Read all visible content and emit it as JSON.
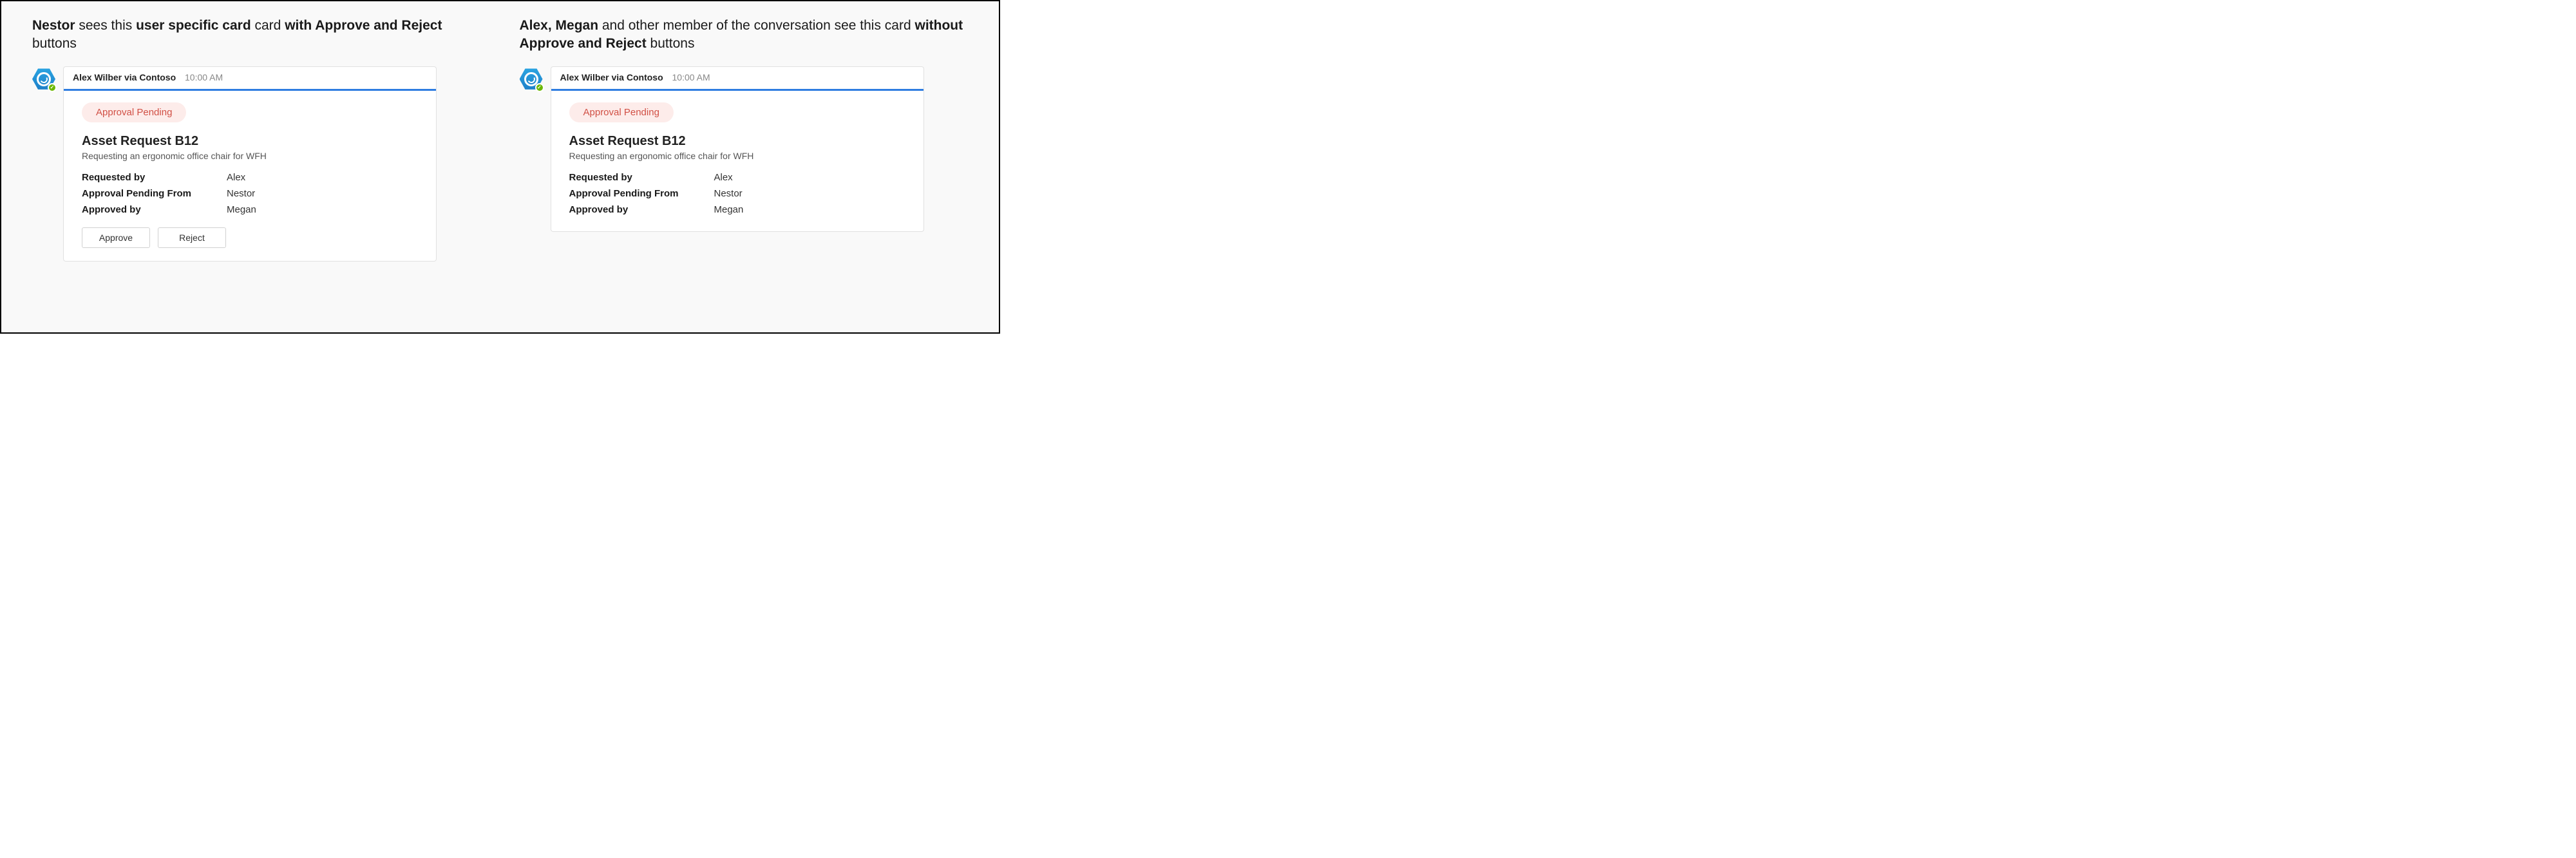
{
  "left": {
    "caption_segments": [
      {
        "text": "Nestor",
        "bold": true
      },
      {
        "text": " sees this ",
        "bold": false
      },
      {
        "text": "user specific card",
        "bold": true
      },
      {
        "text": " card ",
        "bold": false
      },
      {
        "text": "with Approve and Reject",
        "bold": true
      },
      {
        "text": " buttons",
        "bold": false
      }
    ],
    "sender": "Alex Wilber via Contoso",
    "timestamp": "10:00 AM",
    "status": "Approval Pending",
    "title": "Asset Request B12",
    "description": "Requesting an ergonomic office chair for WFH",
    "fields": [
      {
        "label": "Requested by",
        "value": "Alex"
      },
      {
        "label": "Approval Pending From",
        "value": "Nestor"
      },
      {
        "label": "Approved by",
        "value": "Megan"
      }
    ],
    "buttons": {
      "approve": "Approve",
      "reject": "Reject"
    }
  },
  "right": {
    "caption_segments": [
      {
        "text": "Alex, Megan",
        "bold": true
      },
      {
        "text": " and other member of the conversation see this card ",
        "bold": false
      },
      {
        "text": "without Approve and Reject",
        "bold": true
      },
      {
        "text": " buttons",
        "bold": false
      }
    ],
    "sender": "Alex Wilber via Contoso",
    "timestamp": "10:00 AM",
    "status": "Approval Pending",
    "title": "Asset Request B12",
    "description": "Requesting an ergonomic office chair for WFH",
    "fields": [
      {
        "label": "Requested by",
        "value": "Alex"
      },
      {
        "label": "Approval Pending From",
        "value": "Nestor"
      },
      {
        "label": "Approved by",
        "value": "Megan"
      }
    ]
  }
}
